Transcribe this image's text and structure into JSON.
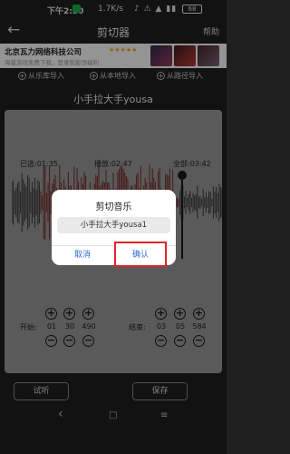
{
  "status_bar": {
    "time": "下午2:50",
    "speed": "1.7K/s",
    "icons": "♪ ⚠ ▲ ▮▮",
    "battery": "68"
  },
  "app_bar": {
    "title": "剪切器",
    "help": "帮助",
    "back_icon": "arrow-left"
  },
  "ad": {
    "company": "北京瓦力网络科技公司",
    "stars": "★★★★★",
    "slogan": "海量游戏免费下载，登录就能领福利"
  },
  "imports": [
    {
      "label": "从乐库导入"
    },
    {
      "label": "从本地导入"
    },
    {
      "label": "从路径导入"
    }
  ],
  "song_title": "小手拉大手yousa",
  "timing": {
    "selected": "已选:01:35",
    "playing": "播放:02:47",
    "total": "全部:03:42"
  },
  "start": {
    "label": "开始:",
    "values": [
      "01",
      "30",
      "490"
    ]
  },
  "end": {
    "label": "结束:",
    "values": [
      "03",
      "05",
      "584"
    ]
  },
  "dialog": {
    "title": "剪切音乐",
    "field_value": "小手拉大手yousa1",
    "cancel": "取消",
    "confirm": "确认"
  },
  "buttons": {
    "preview": "试听",
    "save": "保存"
  },
  "nav": {
    "back": "‹",
    "home": "□",
    "recents": "≡"
  },
  "colors": {
    "background": "#1f1f1f",
    "card": "#9b9b9b",
    "waveform": "#7a2a2a",
    "highlight": "#e0242b",
    "link": "#2f6fd6"
  }
}
